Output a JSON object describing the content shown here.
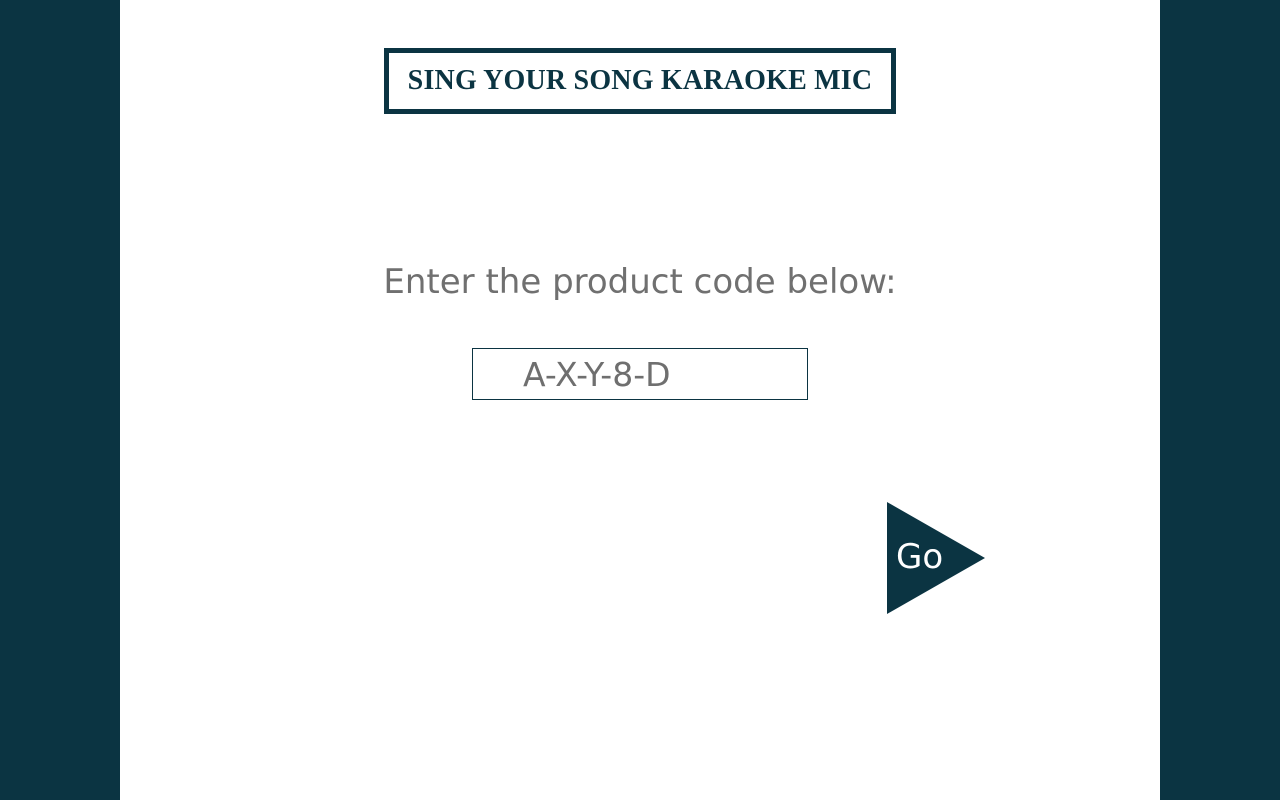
{
  "header": {
    "title": "SING YOUR SONG KARAOKE MIC"
  },
  "form": {
    "prompt": "Enter the product code below:",
    "code_value": "A-X-Y-8-D",
    "go_label": "Go"
  },
  "colors": {
    "brand_dark": "#0b3442",
    "panel_background": "#ffffff",
    "text_gray": "#707070"
  },
  "icons": {
    "go": "play-triangle-icon"
  }
}
